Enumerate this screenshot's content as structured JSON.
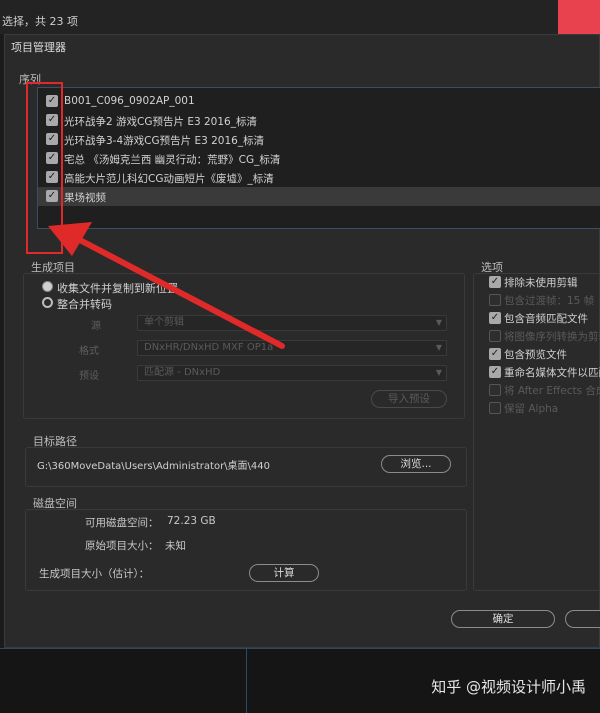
{
  "background": {
    "status_text": "选择，共 23 项"
  },
  "dialog": {
    "title": "项目管理器",
    "sequence_group_label": "序列",
    "sequences": [
      {
        "label": "B001_C096_0902AP_001",
        "checked": true
      },
      {
        "label": "光环战争2 游戏CG预告片 E3 2016_标清",
        "checked": true
      },
      {
        "label": "光环战争3-4游戏CG预告片 E3 2016_标清",
        "checked": true
      },
      {
        "label": "宅总 《汤姆克兰西 幽灵行动：荒野》CG_标清",
        "checked": true
      },
      {
        "label": "高能大片范儿科幻CG动画短片《废墟》_标清",
        "checked": true
      },
      {
        "label": "果场视频",
        "checked": true,
        "selected": true
      }
    ],
    "generate": {
      "label": "生成项目",
      "radio_collect": "收集文件并复制到新位置",
      "radio_consolidate": "整合并转码",
      "source_label": "源",
      "source_value": "单个剪辑",
      "format_label": "格式",
      "format_value": "DNxHR/DNxHD MXF OP1a",
      "preset_label": "预设",
      "preset_value": "匹配源 - DNxHD",
      "import_preset_button": "导入预设"
    },
    "options": {
      "label": "选项",
      "items": [
        {
          "label": "排除未使用剪辑",
          "checked": true,
          "enabled": true
        },
        {
          "label": "包含过渡帧：15 帧",
          "checked": false,
          "enabled": false
        },
        {
          "label": "包含音频匹配文件",
          "checked": true,
          "enabled": true
        },
        {
          "label": "将图像序列转换为剪辑",
          "checked": false,
          "enabled": false
        },
        {
          "label": "包含预览文件",
          "checked": true,
          "enabled": true
        },
        {
          "label": "重命名媒体文件以匹配",
          "checked": true,
          "enabled": true
        },
        {
          "label": "将 After Effects 合成转换",
          "checked": false,
          "enabled": false
        },
        {
          "label": "保留 Alpha",
          "checked": false,
          "enabled": false
        }
      ]
    },
    "target": {
      "label": "目标路径",
      "path": "G:\\360MoveData\\Users\\Administrator\\桌面\\440",
      "browse_button": "浏览..."
    },
    "disk": {
      "label": "磁盘空间",
      "available_label": "可用磁盘空间：",
      "available_value": "72.23 GB",
      "original_label": "原始项目大小：",
      "original_value": "未知",
      "result_label": "生成项目大小（估计）：",
      "compute_button": "计算"
    },
    "ok_button": "确定"
  },
  "watermark": "知乎 @视频设计师小禹",
  "colors": {
    "dialog_bg": "#2a2a2a",
    "annotation_red": "#e02a2a",
    "accent_red": "#e8424f"
  }
}
